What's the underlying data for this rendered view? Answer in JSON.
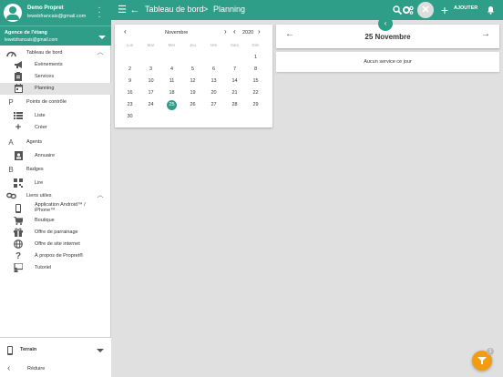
{
  "user": {
    "name": "Demo Propret",
    "email": "lewebfrancais@gmail.com"
  },
  "agency": {
    "title": "Agence de l'étang",
    "email": "lewebfrancais@gmail.com"
  },
  "nav": {
    "sections": [
      {
        "label": "Tableau de bord",
        "items": [
          "Évènements",
          "Services",
          "Planning"
        ]
      },
      {
        "label": "Points de contrôle",
        "items": [
          "Liste",
          "Créer"
        ]
      },
      {
        "label": "Agents",
        "items": [
          "Annuaire"
        ]
      },
      {
        "label": "Badges",
        "items": [
          "Lire"
        ]
      },
      {
        "label": "Liens utiles",
        "items": [
          "Application Android™ / iPhone™",
          "Boutique",
          "Offre de parrainage",
          "Offre de site internet",
          "À propos de Propret®",
          "Tutoriel"
        ]
      }
    ],
    "section_letters": {
      "points": "P",
      "agents": "A",
      "badges": "B"
    },
    "active_item": "Planning"
  },
  "bottom": {
    "terrain": "Terrain",
    "reduce": "Réduire"
  },
  "topbar": {
    "breadcrumb": [
      "Tableau de bord",
      "Planning"
    ],
    "separator": ">",
    "add_label": "AJOUTER"
  },
  "calendar": {
    "month": "Novembre",
    "year": "2020",
    "weekdays": [
      "Lun",
      "Mar",
      "Mer",
      "Jeu",
      "Ven",
      "Sam",
      "Dim"
    ],
    "weeks": [
      [
        "",
        "",
        "",
        "",
        "",
        "",
        "1"
      ],
      [
        "2",
        "3",
        "4",
        "5",
        "6",
        "7",
        "8"
      ],
      [
        "9",
        "10",
        "11",
        "12",
        "13",
        "14",
        "15"
      ],
      [
        "16",
        "17",
        "18",
        "19",
        "20",
        "21",
        "22"
      ],
      [
        "23",
        "24",
        "25",
        "26",
        "27",
        "28",
        "29"
      ],
      [
        "30",
        "",
        "",
        "",
        "",
        "",
        ""
      ]
    ],
    "selected": "25"
  },
  "day": {
    "title": "25 Novembre",
    "empty_message": "Aucun service ce jour"
  },
  "filter_badge": "1",
  "colors": {
    "primary": "#2e9e88",
    "fab": "#f39c12"
  }
}
